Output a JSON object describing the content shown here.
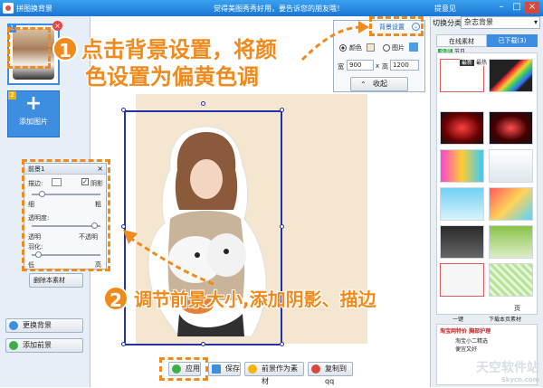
{
  "window": {
    "title": "拼图换背景",
    "center_message": "觉得美图秀秀好用，要告诉您的朋友哦！",
    "help": "提意见"
  },
  "left": {
    "add_photo": "添加图片",
    "change_bg": "更换背景",
    "add_fg": "添加前景",
    "thumb_number": "1",
    "add_number": "2"
  },
  "fg_panel": {
    "title": "前景1",
    "stroke_label": "描边:",
    "shadow_label": "阴影",
    "thin": "细",
    "thick": "粗",
    "opacity_label": "透明度:",
    "transparent": "透明",
    "opaque": "不透明",
    "feather_label": "羽化:",
    "low": "低",
    "high": "高",
    "delete_btn": "删除本素材"
  },
  "bg_settings": {
    "title": "背景设置",
    "color_opt": "颜色",
    "image_opt": "图片",
    "width_label": "宽",
    "width": "900",
    "x": "x",
    "height_label": "高",
    "height": "1200",
    "collapse": "收起"
  },
  "right": {
    "category_label": "切换分类",
    "category_value": "杂志背景",
    "tab_online": "在线素材",
    "tab_downloaded": "已下载(3)",
    "subtab_all": "全部",
    "subtab_holiday": "节日",
    "subtab_latest": "最新",
    "subtab_hot": "最热",
    "page": "页",
    "promo_line": "淘宝网特价 胸部护理",
    "promo_line2": "淘宝小二精选",
    "promo_line3": "便宜又好",
    "one_click": "一键",
    "download_page": "下载本页素材"
  },
  "bottom": {
    "apply": "应用",
    "save": "保存",
    "as_material": "前景作为素材",
    "copy_qq": "复制到qq"
  },
  "callouts": {
    "step1": "点击背景设置，将颜色设置为偏黄色调",
    "step1_line1": "点击背景设置，将颜",
    "step1_line2": "色设置为偏黄色调",
    "step2": "调节前景大小,添加阴影、描边",
    "num1": "1",
    "num2": "2"
  },
  "watermark": {
    "text": "天空软件站",
    "site": "Skycn.com"
  },
  "colors": {
    "accent": "#f08a1c",
    "titlebar": "#1a76d2",
    "photo_bg": "#f5e6cf",
    "selection": "#2630a8"
  }
}
